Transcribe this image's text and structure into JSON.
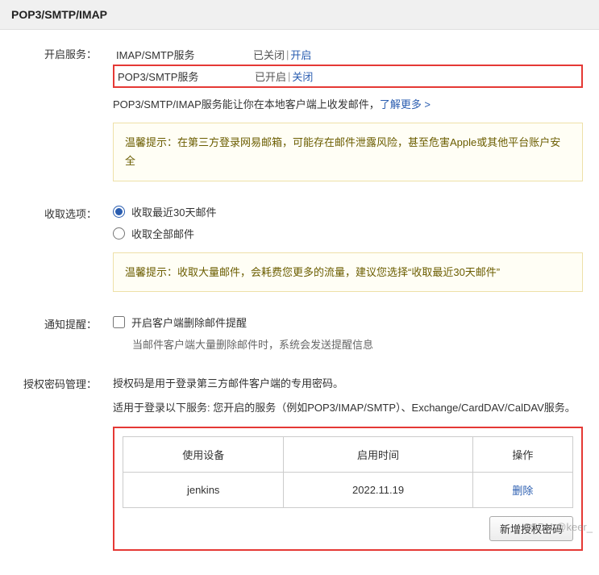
{
  "header": {
    "title": "POP3/SMTP/IMAP"
  },
  "services": {
    "label": "开启服务：",
    "rows": [
      {
        "name": "IMAP/SMTP服务",
        "status": "已关闭",
        "action": "开启"
      },
      {
        "name": "POP3/SMTP服务",
        "status": "已开启",
        "action": "关闭"
      }
    ],
    "desc_prefix": "POP3/SMTP/IMAP服务能让你在本地客户端上收发邮件，",
    "learn_more": "了解更多 >",
    "tip_label": "温馨提示：",
    "tip_text": "在第三方登录网易邮箱，可能存在邮件泄露风险，甚至危害Apple或其他平台账户安全"
  },
  "fetch": {
    "label": "收取选项：",
    "options": [
      {
        "label": "收取最近30天邮件",
        "checked": true
      },
      {
        "label": "收取全部邮件",
        "checked": false
      }
    ],
    "tip_label": "温馨提示：",
    "tip_text": "收取大量邮件，会耗费您更多的流量，建议您选择“收取最近30天邮件”"
  },
  "notify": {
    "label": "通知提醒：",
    "checkbox_label": "开启客户端删除邮件提醒",
    "sub_text": "当邮件客户端大量删除邮件时，系统会发送提醒信息"
  },
  "auth": {
    "label": "授权密码管理：",
    "desc1": "授权码是用于登录第三方邮件客户端的专用密码。",
    "desc2": "适用于登录以下服务: 您开启的服务（例如POP3/IMAP/SMTP）、Exchange/CardDAV/CalDAV服务。",
    "columns": {
      "device": "使用设备",
      "time": "启用时间",
      "action": "操作"
    },
    "rows": [
      {
        "device": "jenkins",
        "time": "2022.11.19",
        "action": "删除"
      }
    ],
    "add_btn": "新增授权密码"
  },
  "watermark": "CSDN @keer_"
}
